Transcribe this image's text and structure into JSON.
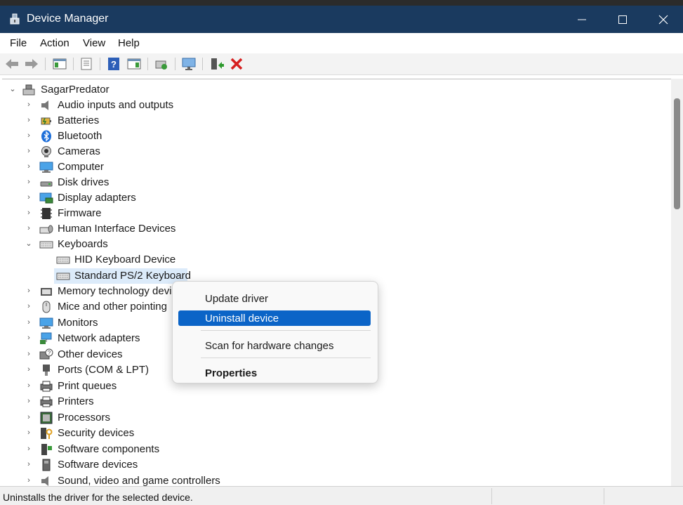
{
  "window": {
    "title": "Device Manager"
  },
  "menu": [
    "File",
    "Action",
    "View",
    "Help"
  ],
  "tree": {
    "root": "SagarPredator",
    "items": [
      {
        "label": "Audio inputs and outputs",
        "icon": "speaker-icon"
      },
      {
        "label": "Batteries",
        "icon": "battery-icon"
      },
      {
        "label": "Bluetooth",
        "icon": "bluetooth-icon"
      },
      {
        "label": "Cameras",
        "icon": "camera-icon"
      },
      {
        "label": "Computer",
        "icon": "computer-icon"
      },
      {
        "label": "Disk drives",
        "icon": "disk-drive-icon"
      },
      {
        "label": "Display adapters",
        "icon": "display-adapter-icon"
      },
      {
        "label": "Firmware",
        "icon": "firmware-chip-icon"
      },
      {
        "label": "Human Interface Devices",
        "icon": "hid-icon"
      },
      {
        "label": "Keyboards",
        "icon": "keyboard-icon",
        "expanded": true,
        "children": [
          "HID Keyboard Device",
          "Standard PS/2 Keyboard"
        ]
      },
      {
        "label": "Memory technology devi",
        "icon": "memory-icon"
      },
      {
        "label": "Mice and other pointing",
        "icon": "mouse-icon"
      },
      {
        "label": "Monitors",
        "icon": "monitor-icon"
      },
      {
        "label": "Network adapters",
        "icon": "network-icon"
      },
      {
        "label": "Other devices",
        "icon": "other-devices-icon"
      },
      {
        "label": "Ports (COM & LPT)",
        "icon": "port-icon"
      },
      {
        "label": "Print queues",
        "icon": "print-queue-icon"
      },
      {
        "label": "Printers",
        "icon": "printer-icon"
      },
      {
        "label": "Processors",
        "icon": "processor-icon"
      },
      {
        "label": "Security devices",
        "icon": "security-device-icon"
      },
      {
        "label": "Software components",
        "icon": "software-component-icon"
      },
      {
        "label": "Software devices",
        "icon": "software-device-icon"
      },
      {
        "label": "Sound, video and game controllers",
        "icon": "sound-icon"
      }
    ],
    "selected": "Standard PS/2 Keyboard"
  },
  "context_menu": {
    "update": "Update driver",
    "uninstall": "Uninstall device",
    "scan": "Scan for hardware changes",
    "properties": "Properties"
  },
  "status": {
    "text": "Uninstalls the driver for the selected device."
  },
  "colors": {
    "titlebar": "#1a3a5f",
    "highlight": "#0b64c7",
    "selection": "#dcebfa"
  }
}
